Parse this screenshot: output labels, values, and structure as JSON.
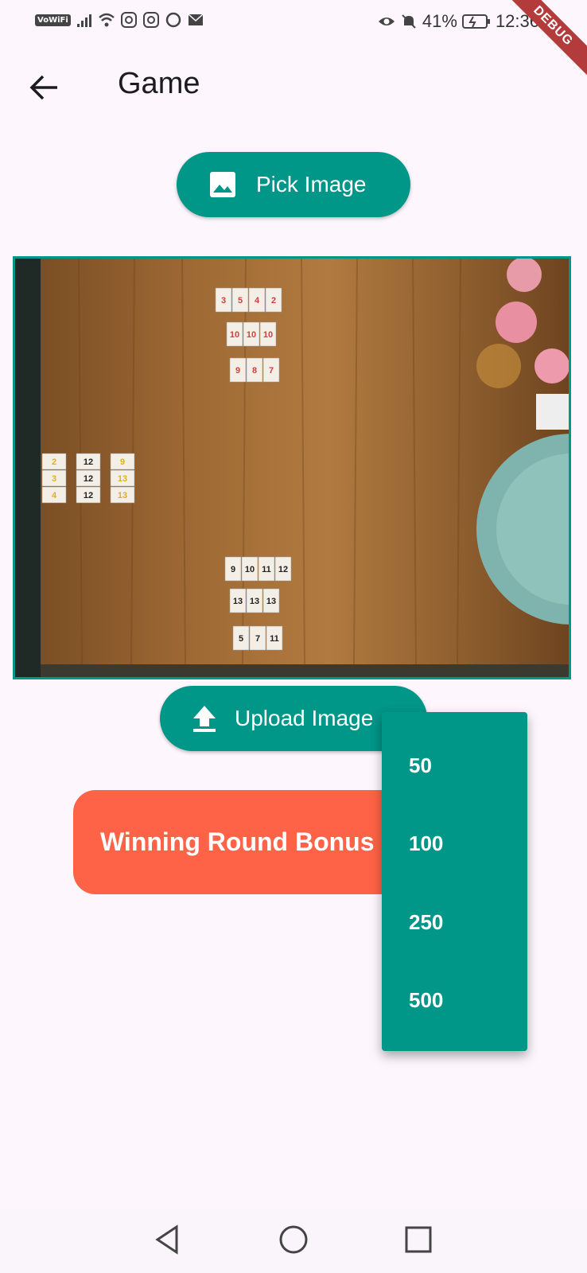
{
  "status_bar": {
    "vowifi": "VoWiFi",
    "battery": "41%",
    "time": "12:36",
    "debug": "DEBUG"
  },
  "app_bar": {
    "title": "Game"
  },
  "pick_button": {
    "label": "Pick Image"
  },
  "upload_button": {
    "label": "Upload Image"
  },
  "bonus_button": {
    "label": "Winning Round Bonus"
  },
  "dropdown": {
    "options": [
      "50",
      "100",
      "250",
      "500"
    ]
  },
  "image": {
    "tiles": {
      "top_row1": [
        "3",
        "5",
        "4",
        "2"
      ],
      "top_row2": [
        "10",
        "10",
        "10"
      ],
      "top_row3": [
        "9",
        "8",
        "7"
      ],
      "left_col1": [
        "2",
        "3",
        "4"
      ],
      "left_col2": [
        "12",
        "12",
        "12"
      ],
      "left_col3": [
        "9",
        "13",
        "13"
      ],
      "bottom_row1": [
        "9",
        "10",
        "11",
        "12"
      ],
      "bottom_row2": [
        "13",
        "13",
        "13"
      ],
      "bottom_row3": [
        "5",
        "7",
        "11"
      ]
    }
  },
  "colors": {
    "accent": "#009688",
    "bonus": "#ff6347",
    "background": "#fdf7fd"
  }
}
